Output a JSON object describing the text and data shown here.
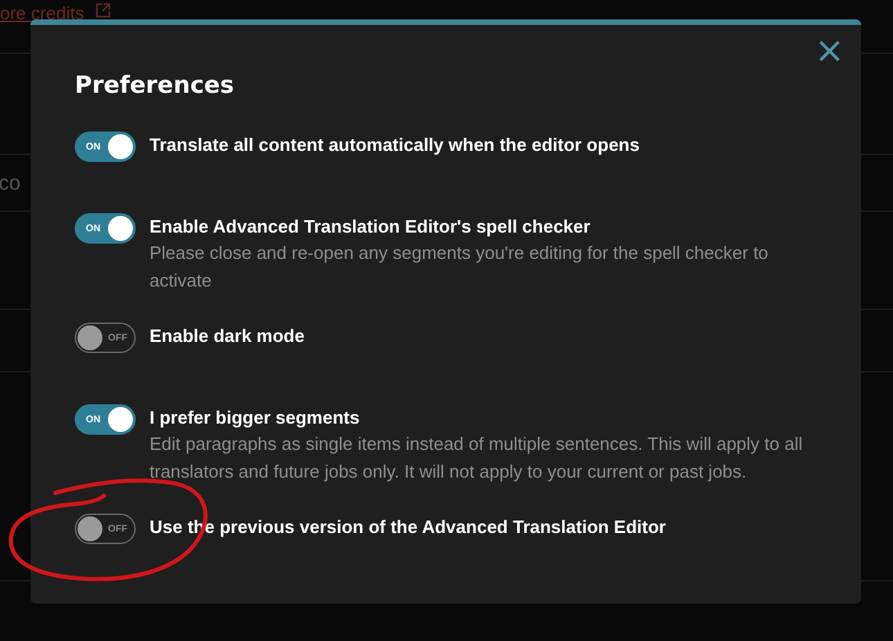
{
  "background": {
    "link": "ore credits",
    "row_text": "co"
  },
  "dialog": {
    "title": "Preferences",
    "close": "×",
    "options": [
      {
        "label": "Translate all content automatically when the editor opens",
        "on": true,
        "toggle_text": "ON"
      },
      {
        "label": "Enable Advanced Translation Editor's spell checker",
        "description": "Please close and re-open any segments you're editing for the spell checker to activate",
        "on": true,
        "toggle_text": "ON"
      },
      {
        "label": "Enable dark mode",
        "on": false,
        "toggle_text": "OFF"
      },
      {
        "label": "I prefer bigger segments",
        "description": "Edit paragraphs as single items instead of multiple sentences. This will apply to all translators and future jobs only. It will not apply to your current or past jobs.",
        "on": true,
        "toggle_text": "ON"
      },
      {
        "label": "Use the previous version of the Advanced Translation Editor",
        "on": false,
        "toggle_text": "OFF"
      }
    ]
  },
  "annotation": {
    "kind": "circle",
    "color": "#d0161b"
  }
}
